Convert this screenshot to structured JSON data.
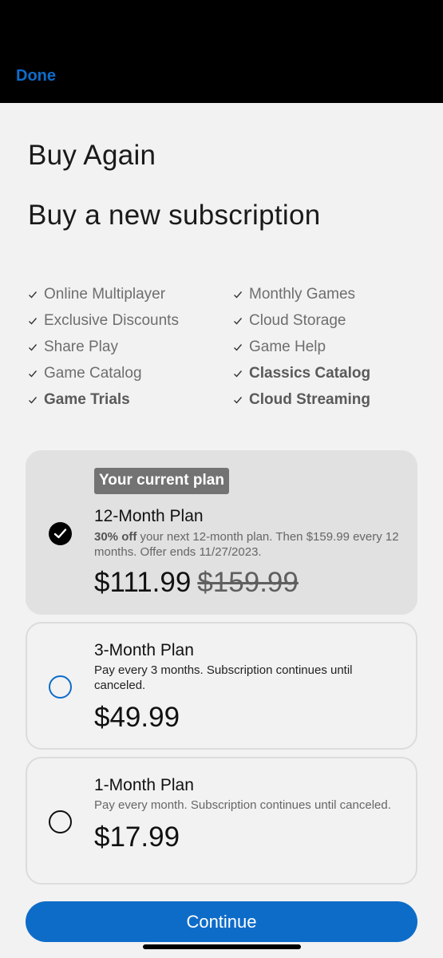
{
  "header": {
    "done_label": "Done"
  },
  "titles": {
    "heading": "Buy Again",
    "subheading": "Buy a new subscription"
  },
  "features": {
    "left": [
      {
        "label": "Online Multiplayer",
        "bold": false
      },
      {
        "label": "Exclusive Discounts",
        "bold": false
      },
      {
        "label": "Share Play",
        "bold": false
      },
      {
        "label": "Game Catalog",
        "bold": false
      },
      {
        "label": "Game Trials",
        "bold": true
      }
    ],
    "right": [
      {
        "label": "Monthly Games",
        "bold": false
      },
      {
        "label": "Cloud Storage",
        "bold": false
      },
      {
        "label": "Game Help",
        "bold": false
      },
      {
        "label": "Classics Catalog",
        "bold": true
      },
      {
        "label": "Cloud Streaming",
        "bold": true
      }
    ]
  },
  "plans": [
    {
      "badge": "Your current plan",
      "name": "12-Month Plan",
      "desc_bold": "30% off",
      "desc": " your next 12-month plan. Then $159.99 every 12 months. Offer ends 11/27/2023.",
      "price": "$111.99",
      "original_price": "$159.99",
      "selected": true
    },
    {
      "name": "3-Month Plan",
      "desc": "Pay every 3 months. Subscription continues until canceled.",
      "price": "$49.99",
      "selected": false
    },
    {
      "name": "1-Month Plan",
      "desc": "Pay every month. Subscription continues until canceled.",
      "price": "$17.99",
      "selected": false
    }
  ],
  "footer": {
    "continue_label": "Continue"
  },
  "colors": {
    "accent": "#0e6cc9",
    "selected_card": "#e1e1e1",
    "badge": "#737373",
    "topbar": "#000000"
  }
}
